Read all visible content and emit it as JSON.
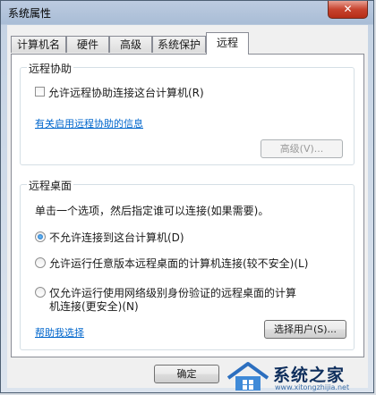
{
  "window": {
    "title": "系统属性",
    "close_label": "✕"
  },
  "tabs": [
    {
      "label": "计算机名"
    },
    {
      "label": "硬件"
    },
    {
      "label": "高级"
    },
    {
      "label": "系统保护"
    },
    {
      "label": "远程"
    }
  ],
  "remote_assistance": {
    "title": "远程协助",
    "checkbox_label": "允许远程协助连接这台计算机(R)",
    "checked": false,
    "info_link": "有关启用远程协助的信息",
    "advanced_button": "高级(V)..."
  },
  "remote_desktop": {
    "title": "远程桌面",
    "instruction": "单击一个选项，然后指定谁可以连接(如果需要)。",
    "options": [
      {
        "label": "不允许连接到这台计算机(D)",
        "checked": true
      },
      {
        "label": "允许运行任意版本远程桌面的计算机连接(较不安全)(L)",
        "checked": false
      },
      {
        "label_line1": "仅允许运行使用网络级别身份验证的远程桌面的计算",
        "label_line2": "机连接(更安全)(N)",
        "checked": false
      }
    ],
    "help_link": "帮助我选择",
    "select_users_button": "选择用户(S)..."
  },
  "footer": {
    "ok_button": "确定"
  },
  "watermark": {
    "text": "系统之家",
    "url": "www.xitongzhijia.net"
  },
  "colors": {
    "link": "#0066cc",
    "close": "#c7432e",
    "radio_fill": "#1b64b5"
  }
}
